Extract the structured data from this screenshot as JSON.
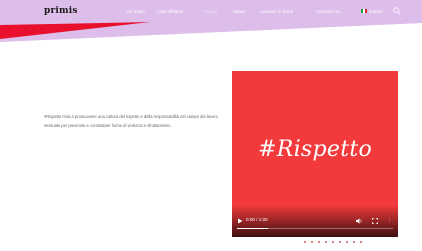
{
  "brand": {
    "logo_text": "primis"
  },
  "nav": {
    "items": [
      {
        "label": "Chi siamo",
        "dropdown": false
      },
      {
        "label": "Cosa offriamo",
        "dropdown": true
      },
      {
        "label": "Progetti",
        "dropdown": false
      },
      {
        "label": "Salute",
        "dropdown": true
      },
      {
        "label": "Lavorare in Ticino",
        "dropdown": true
      },
      {
        "label": "Cosa fare se...",
        "dropdown": true
      }
    ],
    "language": "Italiano",
    "search_icon": "search-icon"
  },
  "intro": {
    "text": "#Rispetto mira a promuovere una cultura del rispetto e della responsabilità nel campo del lavoro sessuale per prevenire e contrastare forme di violenza e sfruttamento."
  },
  "video": {
    "title": "#Rispetto",
    "time": "0:00 / 1:00",
    "progress": 0.2,
    "icons": [
      "play-icon",
      "volume-icon",
      "fullscreen-icon",
      "more-options-icon"
    ]
  },
  "colors": {
    "nav_bg": "#ddbdea",
    "video_bg": "#f23a3c",
    "wedge_red": "#e8102c",
    "text_gray": "#666666"
  }
}
